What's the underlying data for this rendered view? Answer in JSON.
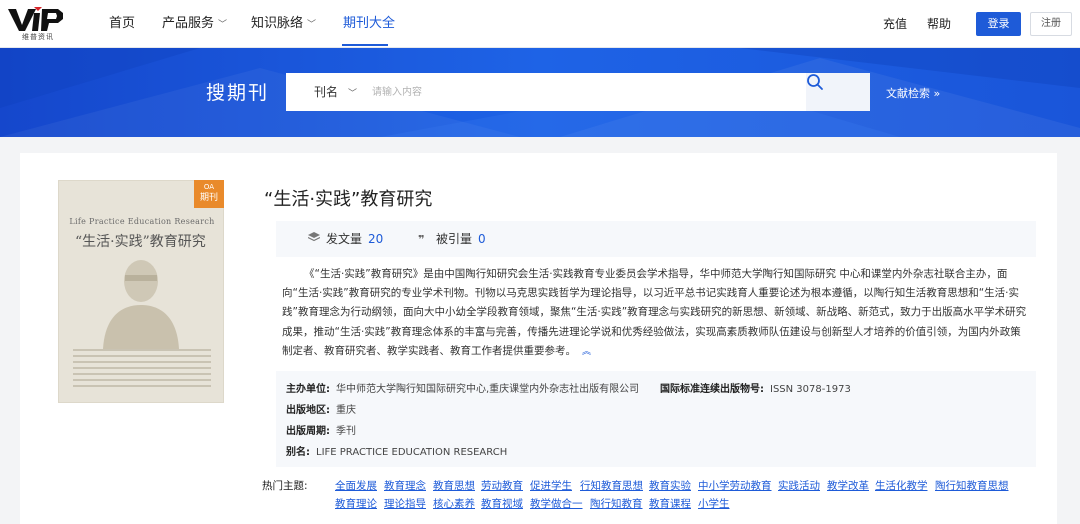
{
  "brand": {
    "logo_text": "VIP",
    "logo_sub": "维普资讯"
  },
  "nav": {
    "items": [
      {
        "label": "首页",
        "has_dropdown": false
      },
      {
        "label": "产品服务",
        "has_dropdown": true
      },
      {
        "label": "知识脉络",
        "has_dropdown": true
      },
      {
        "label": "期刊大全",
        "has_dropdown": false,
        "active": true
      }
    ],
    "recharge": "充值",
    "help": "帮助",
    "login": "登录",
    "register": "注册"
  },
  "banner": {
    "title": "搜期刊",
    "search_type": "刊名",
    "search_placeholder": "请输入内容",
    "advanced_link": "文献检索 »"
  },
  "journal": {
    "title": "“生活·实践”教育研究",
    "badge_top": "OA",
    "badge_bottom": "期刊",
    "cover_title_en": "Life Practice Education Research",
    "cover_title_cn": "“生活·实践”教育研究",
    "stats": {
      "articles_label": "发文量",
      "articles_value": "20",
      "citations_label": "被引量",
      "citations_value": "0"
    },
    "description": "《“生活·实践”教育研究》是由中国陶行知研究会生活·实践教育专业委员会学术指导，华中师范大学陶行知国际研究 中心和课堂内外杂志社联合主办，面向“生活·实践”教育研究的专业学术刊物。刊物以马克思实践哲学为理论指导，以习近平总书记实践育人重要论述为根本遵循，以陶行知生活教育思想和“生活·实践”教育理念为行动纲领，面向大中小幼全学段教育领域，聚焦“生活·实践”教育理念与实践研究的新思想、新领域、新战略、新范式，致力于出版高水平学术研究成果，推动“生活·实践”教育理念体系的丰富与完善，传播先进理论学说和优秀经验做法，实现高素质教师队伍建设与创新型人才培养的价值引领，为国内外政策制定者、教育研究者、教学实践者、教育工作者提供重要参考。",
    "collapse_icon": "double-chevron-up-icon",
    "info": {
      "sponsor_label": "主办单位:",
      "sponsor_value": "华中师范大学陶行知国际研究中心,重庆课堂内外杂志社出版有限公司",
      "issn_label": "国际标准连续出版物号:",
      "issn_value": "ISSN 3078-1973",
      "region_label": "出版地区:",
      "region_value": "重庆",
      "cycle_label": "出版周期:",
      "cycle_value": "季刊",
      "alias_label": "别名:",
      "alias_value": "LIFE PRACTICE EDUCATION RESEARCH"
    },
    "topics_label": "热门主题:",
    "topics": [
      "全面发展",
      "教育理念",
      "教育思想",
      "劳动教育",
      "促进学生",
      "行知教育思想",
      "教育实验",
      "中小学劳动教育",
      "实践活动",
      "教学改革",
      "生活化教学",
      "陶行知教育思想",
      "教育理论",
      "理论指导",
      "核心素养",
      "教育视域",
      "教学做合一",
      "陶行知教育",
      "教育课程",
      "小学生"
    ]
  },
  "colors": {
    "accent": "#1e5bd8",
    "banner": "#1a55d9",
    "badge": "#e98a2b"
  }
}
